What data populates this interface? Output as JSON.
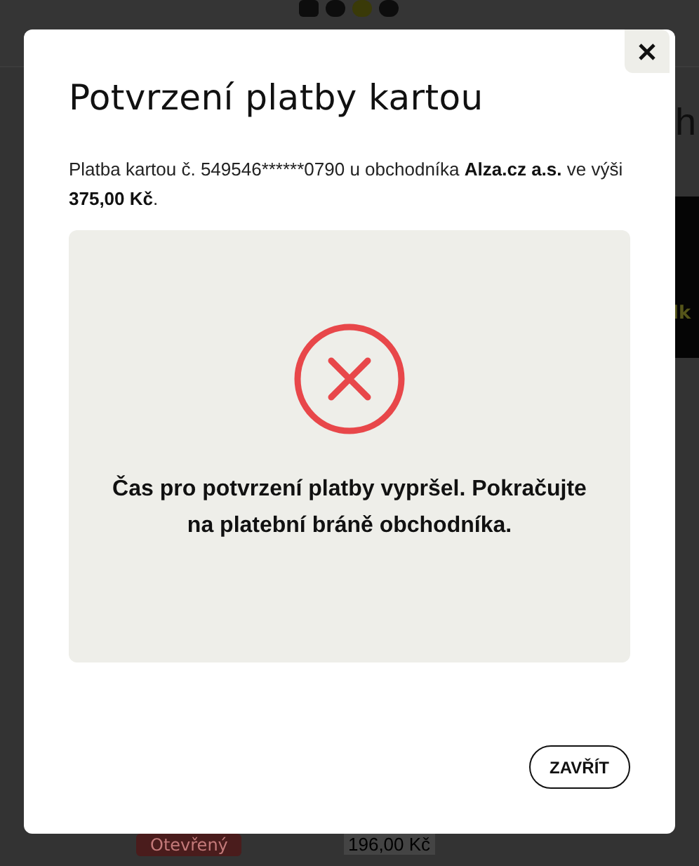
{
  "background": {
    "heading_fragment": "h",
    "banner_fragment": "lk",
    "order": {
      "status": "Otevřený",
      "amount": "196,00 Kč"
    }
  },
  "dialog": {
    "title": "Potvrzení platby kartou",
    "message": [
      {
        "text": "Platba kartou č. 549546******0790 u obchodníka ",
        "bold": false
      },
      {
        "text": "Alza.cz a.s.",
        "bold": true
      },
      {
        "text": " ve výši ",
        "bold": false
      },
      {
        "text": "375,00 Kč",
        "bold": true
      },
      {
        "text": ".",
        "bold": false
      }
    ],
    "result": {
      "kind": "error",
      "text": "Čas pro potvrzení platby vypršel. Pokračujte na platební bráně obchodníka."
    },
    "close_button": "ZAVŘÍT"
  }
}
